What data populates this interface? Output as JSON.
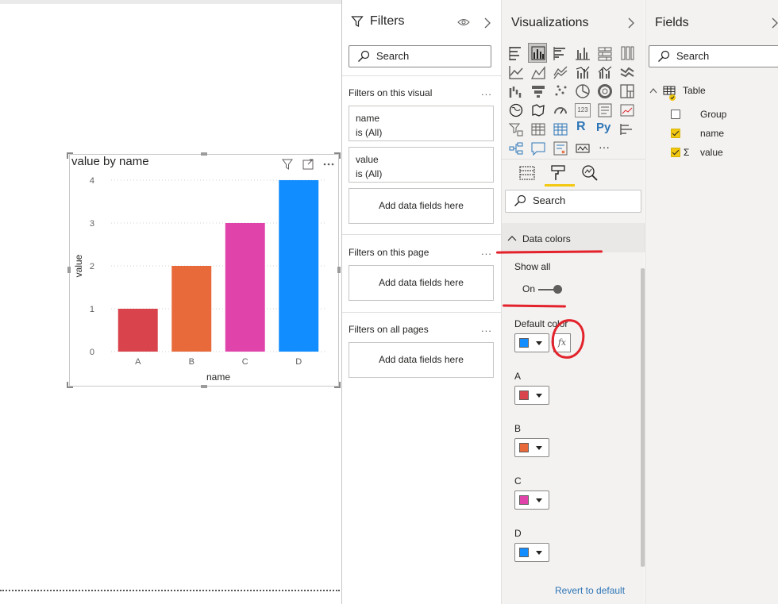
{
  "visual": {
    "title": "value by name",
    "icons": [
      "filter-icon",
      "focus-mode-icon",
      "more-options-icon"
    ]
  },
  "chart_data": {
    "type": "bar",
    "categories": [
      "A",
      "B",
      "C",
      "D"
    ],
    "values": [
      1,
      2,
      3,
      4
    ],
    "colors": [
      "#d9434c",
      "#e8693a",
      "#e044aa",
      "#118dff"
    ],
    "xlabel": "name",
    "ylabel": "value",
    "ylim": [
      0,
      4
    ],
    "yticks": [
      "0",
      "1",
      "2",
      "3",
      "4"
    ],
    "grid": true
  },
  "filters": {
    "title": "Filters",
    "search_placeholder": "Search",
    "on_visual_label": "Filters on this visual",
    "cards": [
      {
        "field": "name",
        "state": "is (All)"
      },
      {
        "field": "value",
        "state": "is (All)"
      }
    ],
    "add_fields": "Add data fields here",
    "on_page_label": "Filters on this page",
    "on_all_pages_label": "Filters on all pages",
    "more": "..."
  },
  "visualizations": {
    "title": "Visualizations",
    "search_placeholder": "Search",
    "section": "Data colors",
    "show_all_label": "Show all",
    "toggle_state": "On",
    "default_color_label": "Default color",
    "fx_label": "fx",
    "colors": [
      {
        "label": "A",
        "color": "#d9434c"
      },
      {
        "label": "B",
        "color": "#e8693a"
      },
      {
        "label": "C",
        "color": "#e044aa"
      },
      {
        "label": "D",
        "color": "#118dff"
      }
    ],
    "default_color": "#118dff",
    "revert": "Revert to default",
    "r_label": "R",
    "py_label": "Py",
    "num_label": "123",
    "ellipsis": "···"
  },
  "fields": {
    "title": "Fields",
    "search_placeholder": "Search",
    "table_name": "Table",
    "items": [
      {
        "name": "Group",
        "checked": false,
        "sigma": false
      },
      {
        "name": "name",
        "checked": true,
        "sigma": false
      },
      {
        "name": "value",
        "checked": true,
        "sigma": true
      }
    ],
    "sigma": "Σ"
  }
}
